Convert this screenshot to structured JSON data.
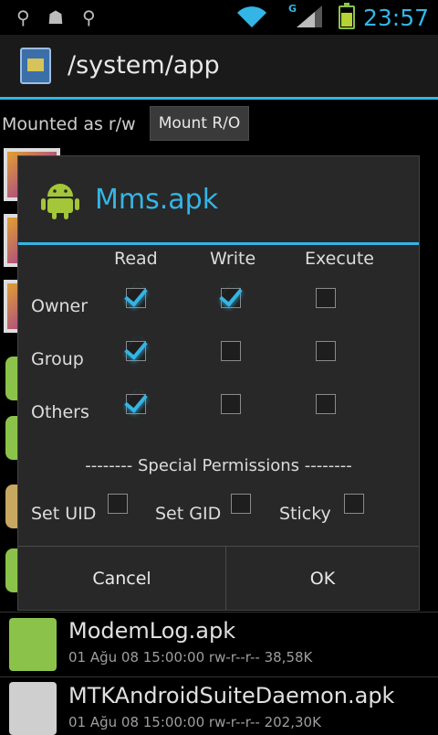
{
  "status_bar": {
    "time": "23:57",
    "network_type": "G",
    "icons": [
      "usb-icon",
      "android-debug-icon",
      "usb-icon",
      "wifi-icon",
      "signal-icon",
      "battery-charging-icon"
    ]
  },
  "action_bar": {
    "title": "/system/app",
    "app_icon": "file-manager-icon"
  },
  "mount": {
    "status": "Mounted as r/w",
    "button": "Mount R/O"
  },
  "file_list": [
    {
      "name": "ModemLog.apk",
      "meta": "01 Ağu 08 15:00:00  rw-r--r--  38,58K",
      "icon": "android-apk-icon"
    },
    {
      "name": "MTKAndroidSuiteDaemon.apk",
      "meta": "01 Ağu 08 15:00:00  rw-r--r--  202,30K",
      "icon": "android-apk-icon"
    }
  ],
  "dialog": {
    "title": "Mms.apk",
    "icon": "android-icon",
    "columns": [
      "Read",
      "Write",
      "Execute"
    ],
    "rows": [
      {
        "label": "Owner",
        "read": true,
        "write": true,
        "execute": false
      },
      {
        "label": "Group",
        "read": true,
        "write": false,
        "execute": false
      },
      {
        "label": "Others",
        "read": true,
        "write": false,
        "execute": false
      }
    ],
    "special_header": "-------- Special Permissions --------",
    "special": [
      {
        "label": "Set UID",
        "checked": false
      },
      {
        "label": "Set GID",
        "checked": false
      },
      {
        "label": "Sticky",
        "checked": false
      }
    ],
    "cancel": "Cancel",
    "ok": "OK"
  },
  "colors": {
    "accent": "#33b5e5",
    "android_green": "#8bc34a",
    "dialog_bg": "#282828"
  }
}
